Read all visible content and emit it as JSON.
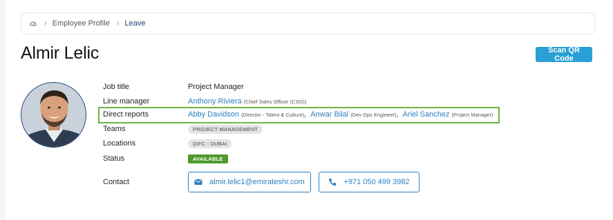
{
  "breadcrumb": {
    "home_icon": "dashboard-icon",
    "items": [
      "Employee Profile",
      "Leave"
    ]
  },
  "profile": {
    "name": "Almir Lelic",
    "scan_button": "Scan QR Code"
  },
  "details": {
    "job_title": {
      "label": "Job title",
      "value": "Project Manager"
    },
    "line_manager": {
      "label": "Line manager",
      "name": "Anthony Riviera",
      "role": "(Chief Sales Officer (CSO))"
    },
    "direct_reports": {
      "label": "Direct reports",
      "items": [
        {
          "name": "Abby Davidson",
          "role": "(Director - Talent & Culture)"
        },
        {
          "name": "Anwar Bilal",
          "role": "(Dev Ops Engineer)"
        },
        {
          "name": "Ariel Sanchez",
          "role": "(Project Manager)"
        }
      ]
    },
    "teams": {
      "label": "Teams",
      "value": "PROJECT MANAGEMENT"
    },
    "locations": {
      "label": "Locations",
      "value": "DIFC - DUBAI"
    },
    "status": {
      "label": "Status",
      "value": "AVAILABLE"
    },
    "contact": {
      "label": "Contact",
      "email": "almir.lelic1@emirateshr.com",
      "phone": "+971 050 499 3982",
      "email_icon": "envelope-icon",
      "phone_icon": "phone-icon"
    }
  },
  "colors": {
    "accent": "#2a9fd6",
    "link": "#2a7fc1",
    "status_available": "#4d9a2e",
    "highlight": "#6db33f"
  }
}
